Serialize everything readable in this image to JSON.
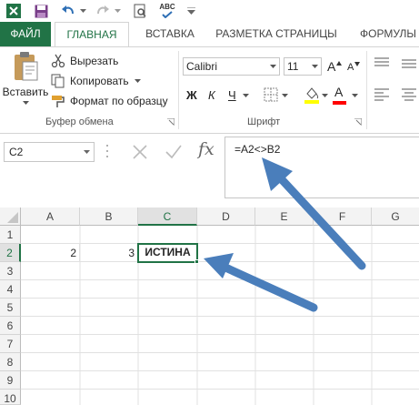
{
  "ribbon_tabs": [
    {
      "label": "ФАЙЛ"
    },
    {
      "label": "ГЛАВНАЯ"
    },
    {
      "label": "ВСТАВКА"
    },
    {
      "label": "РАЗМЕТКА СТРАНИЦЫ"
    },
    {
      "label": "ФОРМУЛЫ"
    }
  ],
  "active_tab": "ГЛАВНАЯ",
  "qat": {
    "spelling_label": "ABC"
  },
  "clipboard": {
    "paste_label": "Вставить",
    "cut_label": "Вырезать",
    "copy_label": "Копировать",
    "format_painter_label": "Формат по образцу",
    "group_label": "Буфер обмена"
  },
  "font": {
    "font_name": "Calibri",
    "font_size": "11",
    "grow_label": "A",
    "shrink_label": "A",
    "bold_label": "Ж",
    "italic_label": "К",
    "underline_label": "Ч",
    "font_color_label": "A",
    "group_label": "Шрифт"
  },
  "formula_bar": {
    "name_box": "C2",
    "fx_label": "fx",
    "formula": "=A2<>B2"
  },
  "grid": {
    "columns": [
      "A",
      "B",
      "C",
      "D",
      "E",
      "F",
      "G"
    ],
    "selected_column": "C",
    "rows": [
      "1",
      "2",
      "3",
      "4",
      "5",
      "6",
      "7",
      "8",
      "9",
      "10"
    ],
    "selected_row": "2",
    "cells": {
      "A2": "2",
      "B2": "3",
      "C2": "ИСТИНА"
    }
  },
  "colors": {
    "excel_green": "#217346",
    "arrow_blue": "#4a7ebb"
  }
}
